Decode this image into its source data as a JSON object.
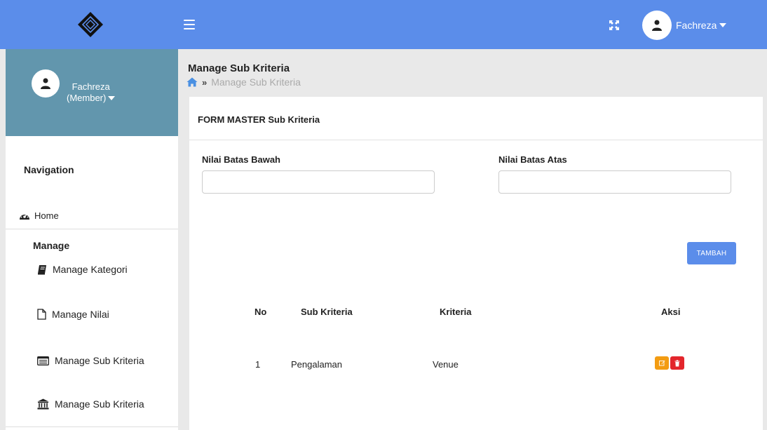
{
  "header": {
    "user_name": "Fachreza"
  },
  "sidebar": {
    "profile": {
      "name": "Fachreza",
      "role": "(Member)"
    },
    "nav_title": "Navigation",
    "home_label": "Home",
    "manage_title": "Manage",
    "items": [
      {
        "label": "Manage Kategori",
        "icon": "book-icon"
      },
      {
        "label": "Manage Nilai",
        "icon": "file-icon"
      },
      {
        "label": "Manage Sub Kriteria",
        "icon": "list-alt-icon"
      },
      {
        "label": "Manage Sub Kriteria",
        "icon": "bank-icon"
      }
    ]
  },
  "page": {
    "title": "Manage Sub Kriteria",
    "breadcrumb": "Manage Sub Kriteria"
  },
  "form": {
    "title": "FORM MASTER Sub Kriteria",
    "label_bawah": "Nilai Batas Bawah",
    "value_bawah": "",
    "label_atas": "Nilai Batas Atas",
    "value_atas": "",
    "submit_label": "TAMBAH"
  },
  "table": {
    "columns": [
      "No",
      "Sub Kriteria",
      "Kriteria",
      "Aksi"
    ],
    "rows": [
      {
        "no": "1",
        "sub_kriteria": "Pengalaman",
        "kriteria": "Venue"
      }
    ]
  },
  "colors": {
    "topbar": "#5b8dea",
    "profile_bg": "#6296ad",
    "edit": "#f39c12",
    "delete": "#e3262c"
  }
}
